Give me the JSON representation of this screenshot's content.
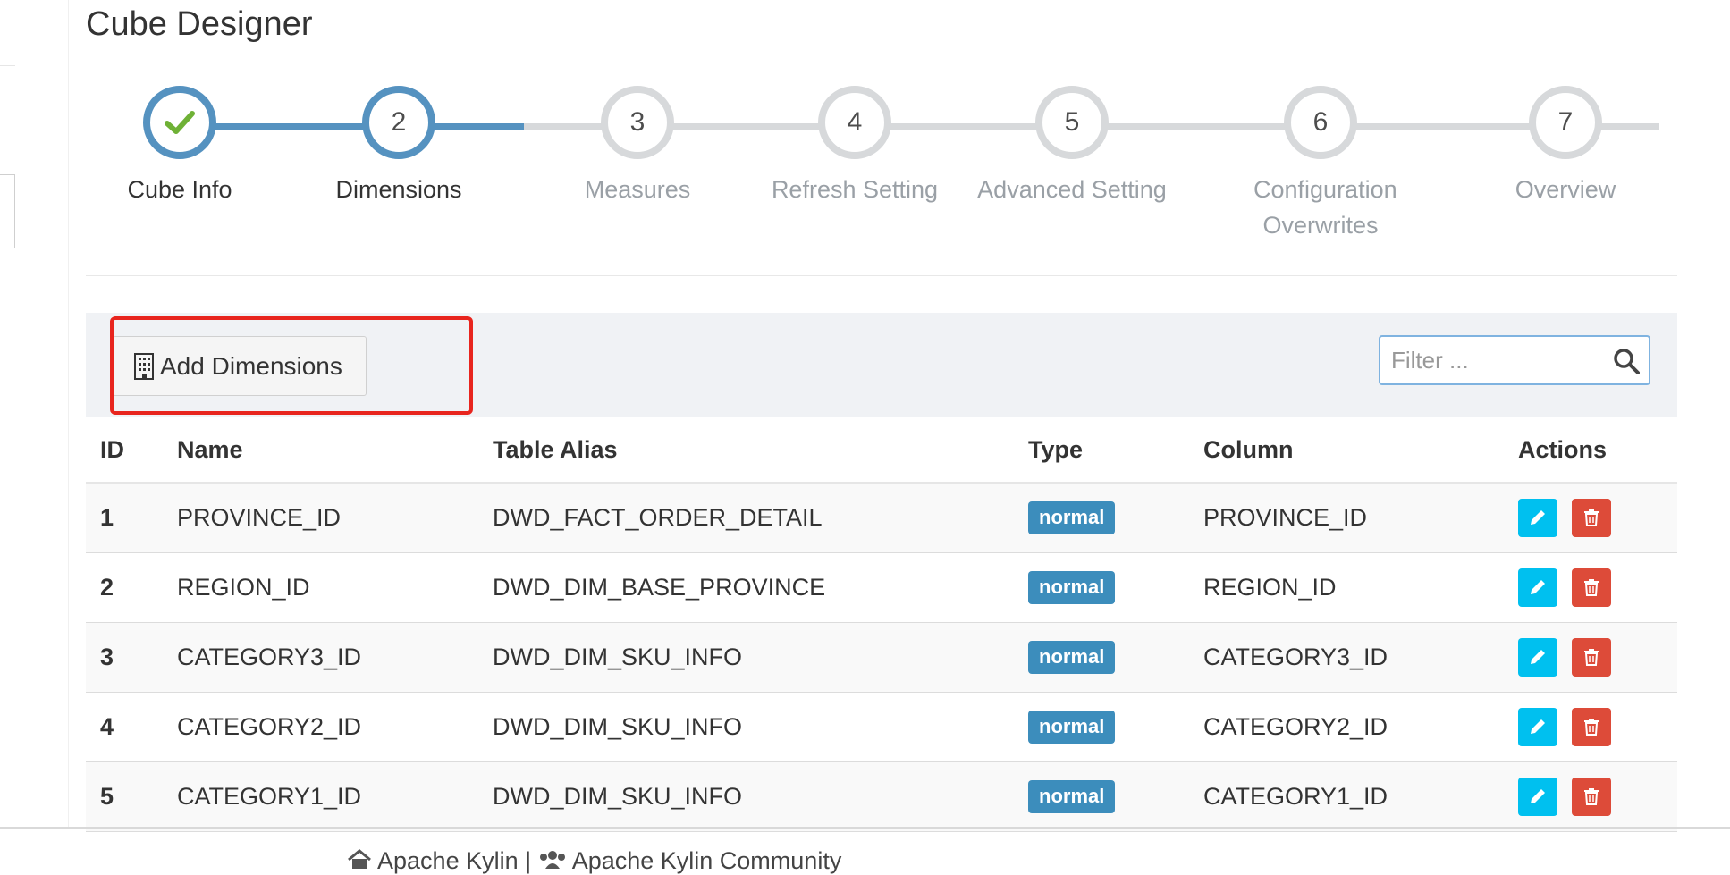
{
  "page": {
    "title": "Cube Designer"
  },
  "wizard": {
    "steps": [
      {
        "number": "",
        "label": "Cube Info",
        "status": "completed"
      },
      {
        "number": "2",
        "label": "Dimensions",
        "status": "active"
      },
      {
        "number": "3",
        "label": "Measures",
        "status": "pending"
      },
      {
        "number": "4",
        "label": "Refresh Setting",
        "status": "pending"
      },
      {
        "number": "5",
        "label": "Advanced Setting",
        "status": "pending"
      },
      {
        "number": "6",
        "label": "Configuration Overwrites",
        "status": "pending"
      },
      {
        "number": "7",
        "label": "Overview",
        "status": "pending"
      }
    ]
  },
  "toolbar": {
    "add_label": "Add Dimensions",
    "filter_placeholder": "Filter ..."
  },
  "table": {
    "headers": [
      "ID",
      "Name",
      "Table Alias",
      "Type",
      "Column",
      "Actions"
    ],
    "rows": [
      {
        "id": "1",
        "name": "PROVINCE_ID",
        "alias": "DWD_FACT_ORDER_DETAIL",
        "type": "normal",
        "column": "PROVINCE_ID"
      },
      {
        "id": "2",
        "name": "REGION_ID",
        "alias": "DWD_DIM_BASE_PROVINCE",
        "type": "normal",
        "column": "REGION_ID"
      },
      {
        "id": "3",
        "name": "CATEGORY3_ID",
        "alias": "DWD_DIM_SKU_INFO",
        "type": "normal",
        "column": "CATEGORY3_ID"
      },
      {
        "id": "4",
        "name": "CATEGORY2_ID",
        "alias": "DWD_DIM_SKU_INFO",
        "type": "normal",
        "column": "CATEGORY2_ID"
      },
      {
        "id": "5",
        "name": "CATEGORY1_ID",
        "alias": "DWD_DIM_SKU_INFO",
        "type": "normal",
        "column": "CATEGORY1_ID"
      }
    ]
  },
  "footer": {
    "link1": "Apache Kylin",
    "separator": "|",
    "link2": "Apache Kylin Community"
  },
  "colors": {
    "active_step": "#5592c0",
    "pending_step": "#d7d9db",
    "badge": "#3c8dbc",
    "edit": "#00c0ef",
    "delete": "#dd4b39",
    "highlight": "#e8251e"
  },
  "icons": {
    "step1": "check-icon",
    "add_button": "building-icon",
    "filter": "search-icon",
    "edit": "pencil-icon",
    "delete": "trash-icon",
    "footer1": "home-icon",
    "footer2": "users-icon"
  }
}
